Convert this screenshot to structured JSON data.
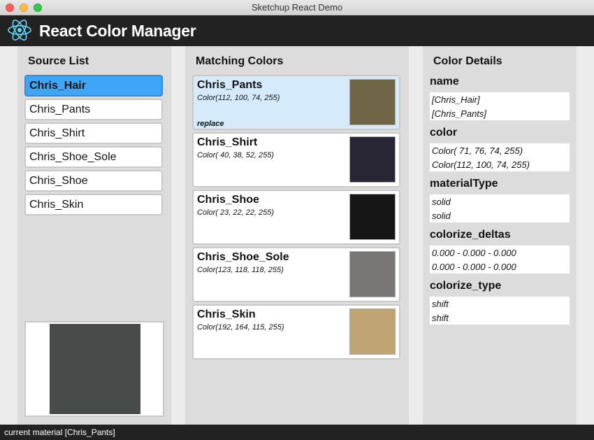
{
  "window": {
    "title": "Sketchup React Demo"
  },
  "header": {
    "title": "React Color Manager",
    "logo_icon": "react-atom-icon"
  },
  "source_list": {
    "title": "Source List",
    "items": [
      "Chris_Hair",
      "Chris_Pants",
      "Chris_Shirt",
      "Chris_Shoe_Sole",
      "Chris_Shoe",
      "Chris_Skin"
    ],
    "selected": "Chris_Hair",
    "preview_color": "#474b4a"
  },
  "matching": {
    "title": "Matching Colors",
    "items": [
      {
        "name": "Chris_Pants",
        "color": "Color(112, 100, 74, 255)",
        "swatch": "#706446",
        "action": "replace",
        "selected": true
      },
      {
        "name": "Chris_Shirt",
        "color": "Color( 40, 38, 52, 255)",
        "swatch": "#282634",
        "selected": false
      },
      {
        "name": "Chris_Shoe",
        "color": "Color( 23, 22, 22, 255)",
        "swatch": "#171616",
        "selected": false
      },
      {
        "name": "Chris_Shoe_Sole",
        "color": "Color(123, 118, 118, 255)",
        "swatch": "#7b7676",
        "selected": false
      },
      {
        "name": "Chris_Skin",
        "color": "Color(192, 164, 115, 255)",
        "swatch": "#c0a473",
        "selected": false
      }
    ]
  },
  "details": {
    "title": "Color Details",
    "fields": [
      {
        "label": "name",
        "values": [
          "[Chris_Hair]",
          "[Chris_Pants]"
        ]
      },
      {
        "label": "color",
        "values": [
          "Color( 71, 76, 74, 255)",
          "Color(112, 100, 74, 255)"
        ]
      },
      {
        "label": "materialType",
        "values": [
          "solid",
          "solid"
        ]
      },
      {
        "label": "colorize_deltas",
        "values": [
          "0.000 - 0.000 - 0.000",
          "0.000 - 0.000 - 0.000"
        ]
      },
      {
        "label": "colorize_type",
        "values": [
          "shift",
          "shift"
        ]
      }
    ]
  },
  "status": {
    "text": "current material [Chris_Pants]"
  }
}
